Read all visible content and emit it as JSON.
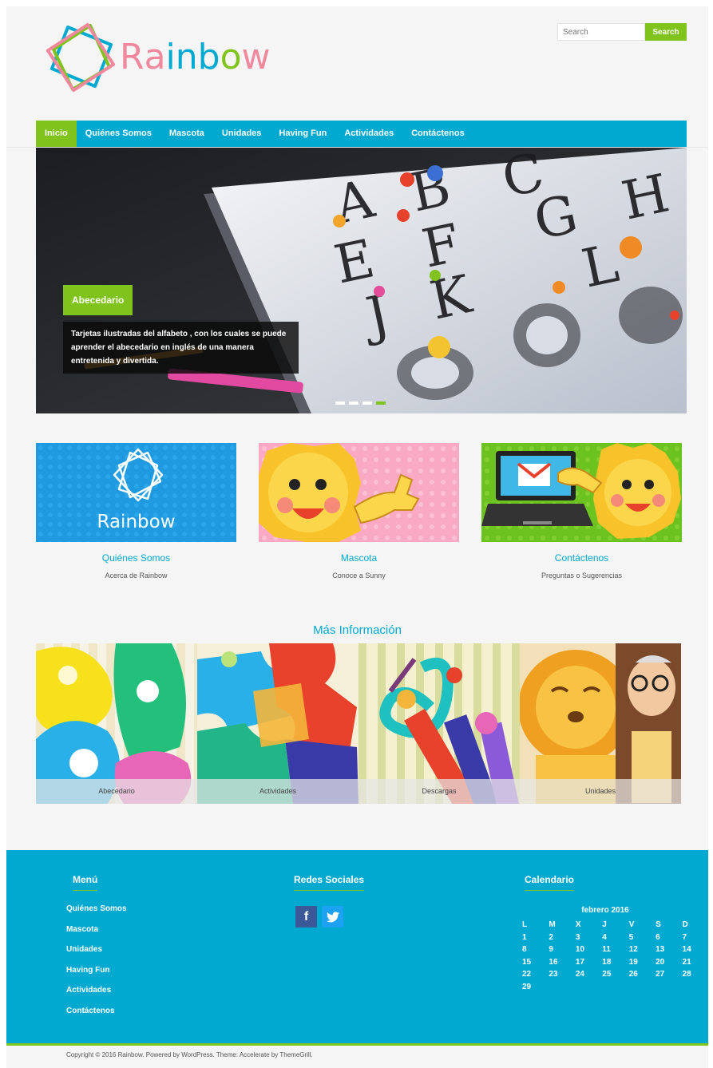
{
  "brand": {
    "name": "Rainbow",
    "letters": [
      {
        "ch": "R",
        "color": "#f2889e"
      },
      {
        "ch": "a",
        "color": "#f2889e"
      },
      {
        "ch": "i",
        "color": "#00a9d0"
      },
      {
        "ch": "n",
        "color": "#00a9d0"
      },
      {
        "ch": "b",
        "color": "#00a9d0"
      },
      {
        "ch": "o",
        "color": "#7fc31c"
      },
      {
        "ch": "w",
        "color": "#f2889e"
      }
    ],
    "accent_blue": "#00a9d0",
    "accent_green": "#7fc31c",
    "accent_pink": "#f2889e"
  },
  "search": {
    "placeholder": "Search",
    "button": "Search"
  },
  "nav": {
    "items": [
      "Inicio",
      "Quiénes Somos",
      "Mascota",
      "Unidades",
      "Having Fun",
      "Actividades",
      "Contáctenos"
    ]
  },
  "slider": {
    "title": "Abecedario",
    "description": "Tarjetas ilustradas del alfabeto , con los cuales se puede aprender el abecedario en inglés de una manera entretenida y divertida.",
    "dots": 4,
    "active_dot": 3
  },
  "featured": [
    {
      "title": "Quiénes Somos",
      "subtitle": "Acerca de Rainbow",
      "logo_text": "Rainbow"
    },
    {
      "title": "Mascota",
      "subtitle": "Conoce a Sunny"
    },
    {
      "title": "Contáctenos",
      "subtitle": "Preguntas o Sugerencias"
    }
  ],
  "more_info": {
    "title": "Más Información",
    "items": [
      "Abecedario",
      "Actividades",
      "Descargas",
      "Unidades"
    ]
  },
  "footer": {
    "menu_title": "Menú",
    "menu_items": [
      "Quiénes Somos",
      "Mascota",
      "Unidades",
      "Having Fun",
      "Actividades",
      "Contáctenos"
    ],
    "social_title": "Redes Sociales",
    "social": [
      {
        "icon": "facebook-icon",
        "glyph": "f",
        "color": "#3b5998"
      },
      {
        "icon": "twitter-icon",
        "glyph": "t",
        "color": "#1da1f2"
      }
    ],
    "calendar_title": "Calendario",
    "calendar": {
      "caption": "febrero 2016",
      "days": [
        "L",
        "M",
        "X",
        "J",
        "V",
        "S",
        "D"
      ],
      "weeks": [
        [
          "1",
          "2",
          "3",
          "4",
          "5",
          "6",
          "7"
        ],
        [
          "8",
          "9",
          "10",
          "11",
          "12",
          "13",
          "14"
        ],
        [
          "15",
          "16",
          "17",
          "18",
          "19",
          "20",
          "21"
        ],
        [
          "22",
          "23",
          "24",
          "25",
          "26",
          "27",
          "28"
        ],
        [
          "29",
          "",
          "",
          "",
          "",
          "",
          ""
        ]
      ]
    }
  },
  "copyright": "Copyright © 2016 Rainbow. Powered by WordPress. Theme: Accelerate by ThemeGrill."
}
